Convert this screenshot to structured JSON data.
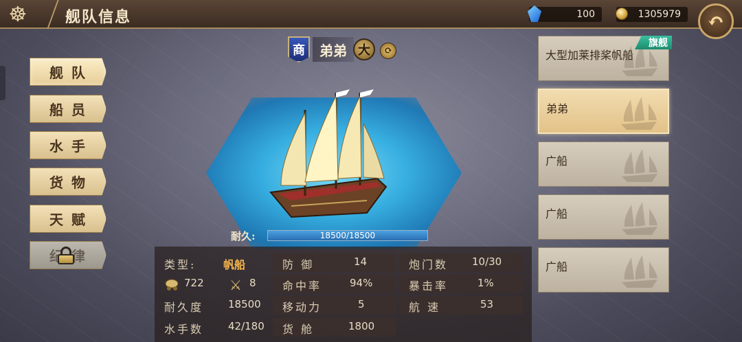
{
  "header": {
    "title": "舰队信息",
    "gems": "100",
    "gold": "1305979",
    "back_label": "↶"
  },
  "nav": {
    "items": [
      {
        "label": "舰队",
        "active": true
      },
      {
        "label": "船员",
        "active": false
      },
      {
        "label": "水手",
        "active": false
      },
      {
        "label": "货物",
        "active": false
      },
      {
        "label": "天赋",
        "active": false
      },
      {
        "label": "纪律",
        "locked": true
      }
    ]
  },
  "ship": {
    "type_badge": "商",
    "name": "弟弟",
    "size_badge": "大",
    "durability_label": "耐久:",
    "durability_text": "18500/18500",
    "durability_fraction": 1.0
  },
  "stats": {
    "type_label": "类型:",
    "type_value": "帆船",
    "cannon_count": "722",
    "crew_icon_count": "8",
    "durability_label": "耐久度",
    "durability_value": "18500",
    "sailors_label": "水手数",
    "sailors_value": "42/180",
    "defense_label": "防 御",
    "defense_value": "14",
    "accuracy_label": "命中率",
    "accuracy_value": "94%",
    "mobility_label": "移动力",
    "mobility_value": "5",
    "cargo_label": "货 舱",
    "cargo_value": "1800",
    "gunports_label": "炮门数",
    "gunports_value": "10/30",
    "crit_label": "暴击率",
    "crit_value": "1%",
    "speed_label": "航 速",
    "speed_value": "53"
  },
  "fleet": {
    "flagship_tag": "旗舰",
    "ships": [
      {
        "name": "大型加莱排桨帆船",
        "selected": false
      },
      {
        "name": "弟弟",
        "selected": true
      },
      {
        "name": "广船",
        "selected": false
      },
      {
        "name": "广船",
        "selected": false
      },
      {
        "name": "广船",
        "selected": false
      }
    ]
  },
  "colors": {
    "accent_gold": "#f2b34c",
    "badge_blue": "#1d2f78",
    "flagship_green": "#1f8a6e"
  }
}
